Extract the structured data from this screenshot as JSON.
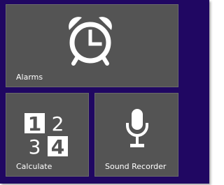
{
  "tiles": {
    "alarms": {
      "label": "Alarms",
      "icon": "alarm-clock-icon"
    },
    "calculate": {
      "label": "Calculate",
      "icon": "calculator-icon",
      "digits": [
        "1",
        "2",
        "3",
        "4"
      ]
    },
    "sound_recorder": {
      "label": "Sound Recorder",
      "icon": "microphone-icon"
    }
  },
  "colors": {
    "start_background": "#200762",
    "tile_background": "#545454",
    "tile_text": "#ffffff"
  }
}
